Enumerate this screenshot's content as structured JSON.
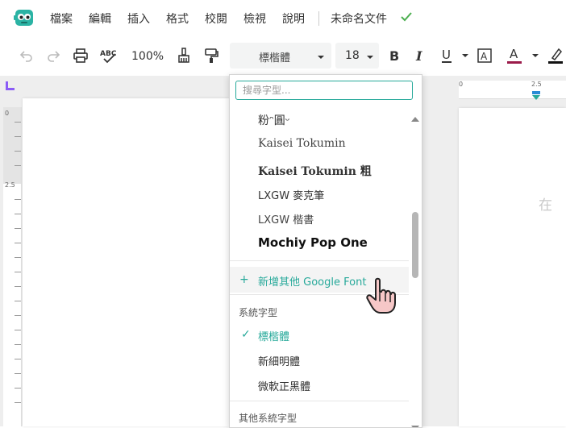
{
  "menubar": {
    "items": [
      {
        "label": "檔案",
        "name": "menu-file"
      },
      {
        "label": "編輯",
        "name": "menu-edit"
      },
      {
        "label": "插入",
        "name": "menu-insert"
      },
      {
        "label": "格式",
        "name": "menu-format"
      },
      {
        "label": "校閱",
        "name": "menu-review"
      },
      {
        "label": "檢視",
        "name": "menu-view"
      },
      {
        "label": "說明",
        "name": "menu-help"
      }
    ],
    "doc_title": "未命名文件"
  },
  "toolbar": {
    "zoom": "100%",
    "font_family": "標楷體",
    "font_size": "18"
  },
  "ruler": {
    "h_start": "0",
    "h_mark": "2.5",
    "v_start": "0",
    "v_mark": "2.5"
  },
  "page": {
    "right_text": "在"
  },
  "dropdown": {
    "search_placeholder": "搜尋字型...",
    "fonts": [
      {
        "label": "粉ᵔ圓ᵕ"
      },
      {
        "label": "Kaisei Tokumin"
      },
      {
        "label": "Kaisei Tokumin 粗"
      },
      {
        "label": "LXGW 麥克筆"
      },
      {
        "label": "LXGW 楷書"
      },
      {
        "label": "Mochiy Pop One"
      }
    ],
    "add_plus": "+",
    "add_label": "新增其他 Google Font",
    "system_section": "系統字型",
    "system_fonts": [
      {
        "label": "標楷體",
        "selected": true
      },
      {
        "label": "新細明體",
        "selected": false
      },
      {
        "label": "微軟正黑體",
        "selected": false
      }
    ],
    "selected_check": "✓",
    "other_section": "其他系統字型"
  },
  "colors": {
    "accent": "#27a99a",
    "ruler_corner": "#8b5cf6",
    "text_color_bar": "#9b1b4a",
    "saved_check": "#4caf50"
  }
}
